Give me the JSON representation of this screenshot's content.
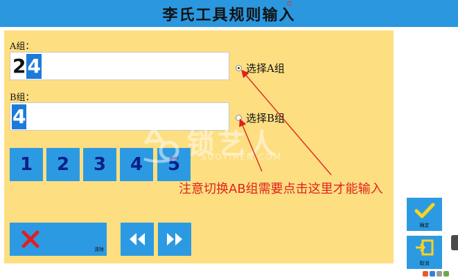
{
  "window": {
    "title": "李氏工具规则输入"
  },
  "group_a": {
    "label": "A组：",
    "value_chars": [
      "2",
      "4"
    ],
    "radio_label": "选择A组",
    "selected": true
  },
  "group_b": {
    "label": "B组：",
    "value_chars": [
      "4"
    ],
    "radio_label": "选择B组",
    "selected": false
  },
  "keypad": {
    "keys": [
      "1",
      "2",
      "3",
      "4",
      "5"
    ]
  },
  "actions": {
    "clear_label": "清除",
    "prev_icon": "rewind-icon",
    "next_icon": "fast-forward-icon"
  },
  "side_buttons": {
    "confirm_label": "确定",
    "cancel_label": "取消"
  },
  "watermark": {
    "main": "锁艺人",
    "sub": "SUOYIREN.COM"
  },
  "annotation": {
    "text": "注意切换AB组需要点击这里才能输入"
  },
  "colors": {
    "titlebar": "#2a97de",
    "panel": "#fddf82",
    "button": "#2c9ae2",
    "selection": "#1c7ad8",
    "annotation": "#e0221d",
    "clear_x": "#e02020",
    "confirm_check": "#ffd21e"
  }
}
